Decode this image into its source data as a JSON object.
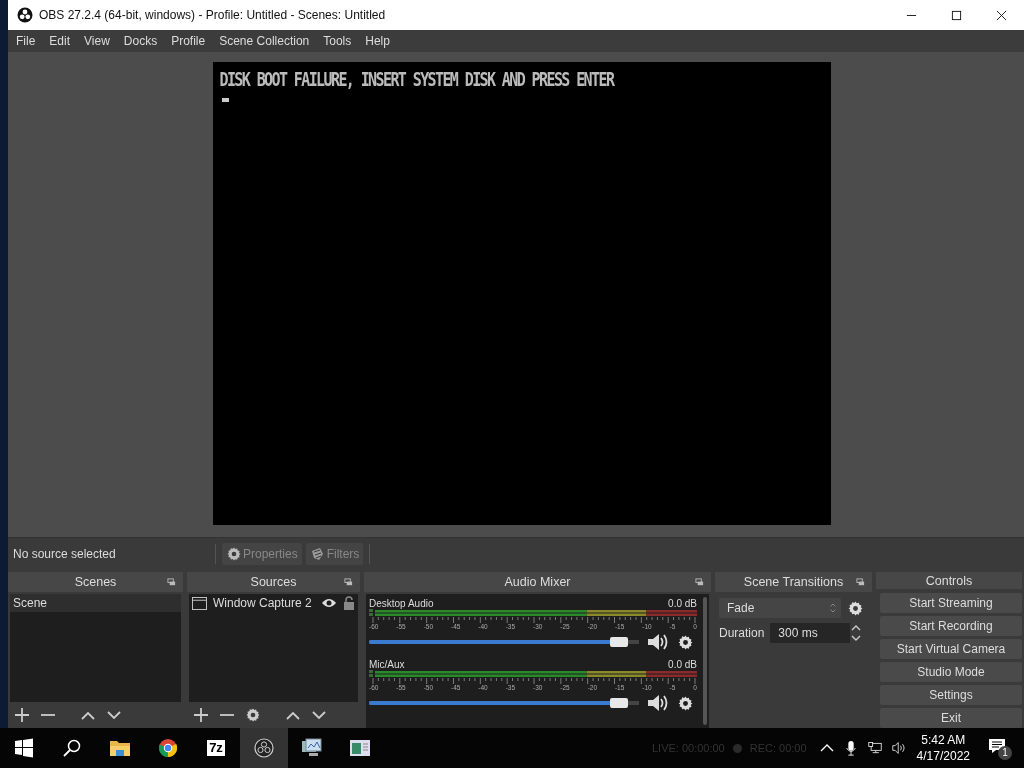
{
  "window": {
    "title": "OBS 27.2.4 (64-bit, windows) - Profile: Untitled - Scenes: Untitled"
  },
  "menu": [
    "File",
    "Edit",
    "View",
    "Docks",
    "Profile",
    "Scene Collection",
    "Tools",
    "Help"
  ],
  "preview": {
    "lines": [
      "DISK BOOT FAILURE, INSERT SYSTEM DISK AND PRESS ENTER"
    ]
  },
  "source_toolbar": {
    "status": "No source selected",
    "buttons": [
      {
        "label": "Properties",
        "kind": "properties",
        "disabled": true
      },
      {
        "label": "Filters",
        "kind": "filters",
        "disabled": true
      }
    ]
  },
  "scenes": {
    "title": "Scenes",
    "items": [
      {
        "name": "Scene",
        "selected": true
      }
    ]
  },
  "sources": {
    "title": "Sources",
    "items": [
      {
        "name": "Window Capture 2",
        "visible": true,
        "locked": false,
        "selected": false
      }
    ]
  },
  "audio_mixer": {
    "title": "Audio Mixer",
    "channels": [
      {
        "name": "Desktop Audio",
        "reading": "0.0 dB",
        "level": 0.96,
        "muted": false,
        "scale": [
          "-60",
          "-55",
          "-50",
          "-45",
          "-40",
          "-35",
          "-30",
          "-25",
          "-20",
          "-15",
          "-10",
          "-5",
          "0"
        ]
      },
      {
        "name": "Mic/Aux",
        "reading": "0.0 dB",
        "level": 0.96,
        "muted": false,
        "scale": [
          "-60",
          "-55",
          "-50",
          "-45",
          "-40",
          "-35",
          "-30",
          "-25",
          "-20",
          "-15",
          "-10",
          "-5",
          "0"
        ]
      }
    ]
  },
  "scene_transitions": {
    "title": "Scene Transitions",
    "transition": "Fade",
    "duration_label": "Duration",
    "duration": "300 ms"
  },
  "controls": {
    "title": "Controls",
    "buttons": [
      "Start Streaming",
      "Start Recording",
      "Start Virtual Camera",
      "Studio Mode",
      "Settings",
      "Exit"
    ]
  },
  "status_bar": {
    "live": "LIVE: 00:00:00",
    "rec": "REC: 00:00"
  },
  "taskbar": {
    "apps": [
      {
        "kind": "start",
        "active": false
      },
      {
        "kind": "search",
        "active": false
      },
      {
        "kind": "explorer",
        "active": false
      },
      {
        "kind": "chrome",
        "active": false
      },
      {
        "kind": "archiver",
        "label": "7z",
        "active": false
      },
      {
        "kind": "obs",
        "active": true
      },
      {
        "kind": "monitor",
        "active": false
      },
      {
        "kind": "app",
        "active": false
      }
    ],
    "time": "5:42 AM",
    "date": "4/17/2022",
    "notifications": "1"
  }
}
